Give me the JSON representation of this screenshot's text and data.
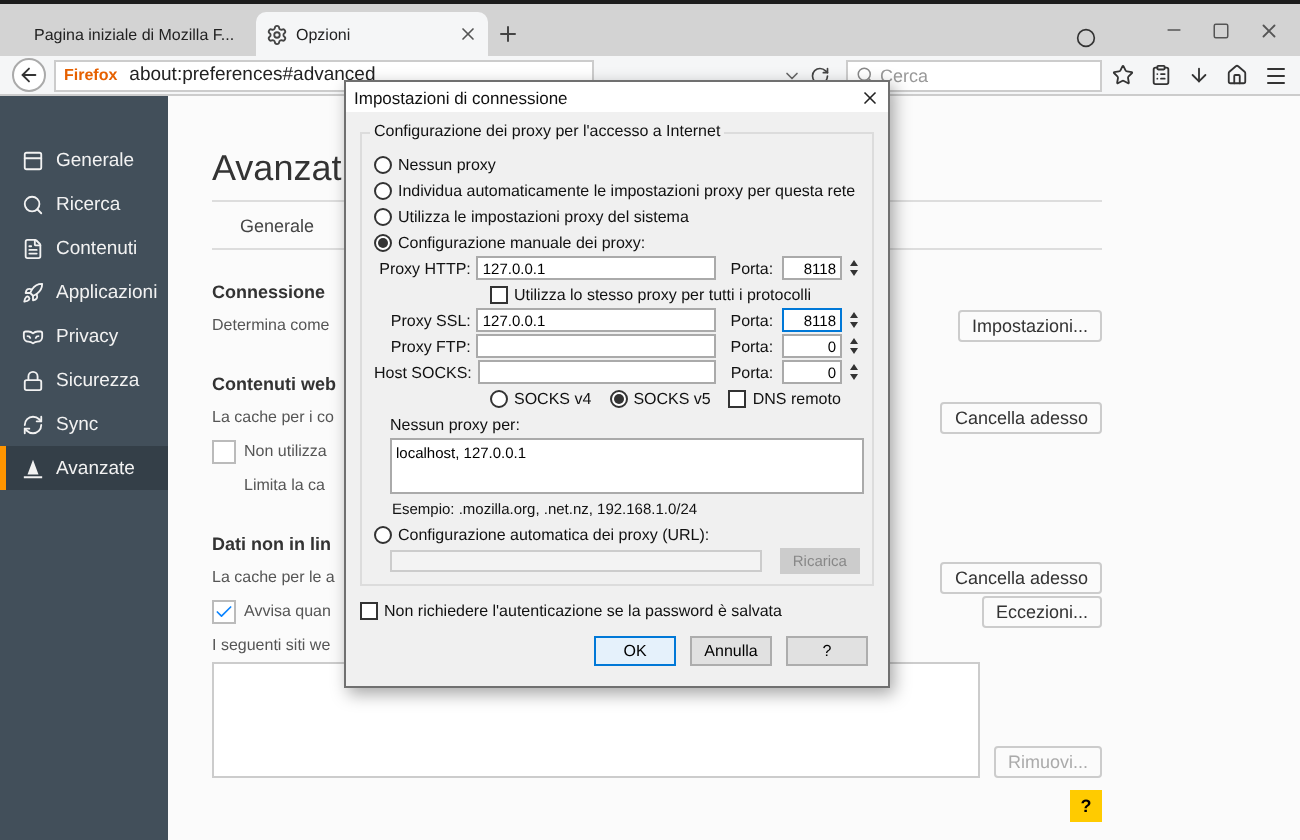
{
  "browser": {
    "tabs": [
      {
        "title": "Pagina iniziale di Mozilla F...",
        "selected": false
      },
      {
        "title": "Opzioni",
        "selected": true
      }
    ],
    "identity": "Firefox",
    "url": "about:preferences#advanced",
    "search": {
      "placeholder": "Cerca"
    }
  },
  "sidebar": {
    "items": [
      {
        "label": "Generale",
        "selected": false
      },
      {
        "label": "Ricerca",
        "selected": false
      },
      {
        "label": "Contenuti",
        "selected": false
      },
      {
        "label": "Applicazioni",
        "selected": false
      },
      {
        "label": "Privacy",
        "selected": false
      },
      {
        "label": "Sicurezza",
        "selected": false
      },
      {
        "label": "Sync",
        "selected": false
      },
      {
        "label": "Avanzate",
        "selected": true
      }
    ]
  },
  "page": {
    "title": "Avanzat",
    "subtabs": [
      "Generale"
    ],
    "rows": [
      {
        "kind": "heading",
        "text": "Connessione"
      },
      {
        "kind": "text",
        "text": "Determina come",
        "button": {
          "label": "Impostazioni...",
          "disabled": false
        }
      },
      {
        "kind": "heading",
        "text": "Contenuti web"
      },
      {
        "kind": "text",
        "text": "La cache per i co",
        "button": {
          "label": "Cancella adesso",
          "disabled": false
        }
      },
      {
        "kind": "checkbox",
        "text": "Non utilizza",
        "checked": false
      },
      {
        "kind": "hint",
        "text": "Limita la ca"
      },
      {
        "kind": "heading",
        "text": "Dati non in lin"
      },
      {
        "kind": "text",
        "text": "La cache per le a",
        "button": {
          "label": "Cancella adesso",
          "disabled": false
        }
      },
      {
        "kind": "checkbox",
        "text": "Avvisa quan",
        "checked": true,
        "button": {
          "label": "Eccezioni...",
          "disabled": false
        }
      },
      {
        "kind": "text",
        "text": "I seguenti siti we"
      },
      {
        "kind": "listbox",
        "button": {
          "label": "Rimuovi...",
          "disabled": true
        }
      }
    ],
    "help": "?"
  },
  "dialog": {
    "title": "Impostazioni di connessione",
    "group": "Configurazione dei proxy per l'accesso a Internet",
    "modes": [
      {
        "label": "Nessun proxy",
        "selected": false
      },
      {
        "label": "Individua automaticamente le impostazioni proxy per questa rete",
        "selected": false
      },
      {
        "label": "Utilizza le impostazioni proxy del sistema",
        "selected": false
      },
      {
        "label": "Configurazione manuale dei proxy:",
        "selected": true
      }
    ],
    "proxies": [
      {
        "label": "Proxy HTTP:",
        "host": "127.0.0.1",
        "port_label": "Porta:",
        "port": "8118",
        "focused": false
      },
      {
        "label": "Proxy SSL:",
        "host": "127.0.0.1",
        "port_label": "Porta:",
        "port": "8118",
        "focused": true
      },
      {
        "label": "Proxy FTP:",
        "port_label": "Porta:",
        "port": "0",
        "focused": false
      },
      {
        "label": "Host SOCKS:",
        "port_label": "Porta:",
        "port": "0",
        "focused": false
      }
    ],
    "same_proxy": {
      "label": "Utilizza lo stesso proxy per tutti i protocolli",
      "checked": false
    },
    "socks": [
      {
        "label": "SOCKS v4",
        "selected": false
      },
      {
        "label": "SOCKS v5",
        "selected": true
      }
    ],
    "dns": {
      "label": "DNS remoto",
      "checked": false
    },
    "no_proxy_label": "Nessun proxy per:",
    "no_proxy": "localhost, 127.0.0.1",
    "example": "Esempio: .mozilla.org, .net.nz, 192.168.1.0/24",
    "auto": {
      "label": "Configurazione automatica dei proxy (URL):",
      "selected": false
    },
    "reload": {
      "label": "Ricarica",
      "disabled": true
    },
    "no_auth": {
      "label": "Non richiedere l'autenticazione se la password è salvata",
      "checked": false
    },
    "buttons": [
      {
        "label": "OK",
        "focused": true
      },
      {
        "label": "Annulla",
        "focused": false
      },
      {
        "label": "?",
        "focused": false
      }
    ]
  }
}
